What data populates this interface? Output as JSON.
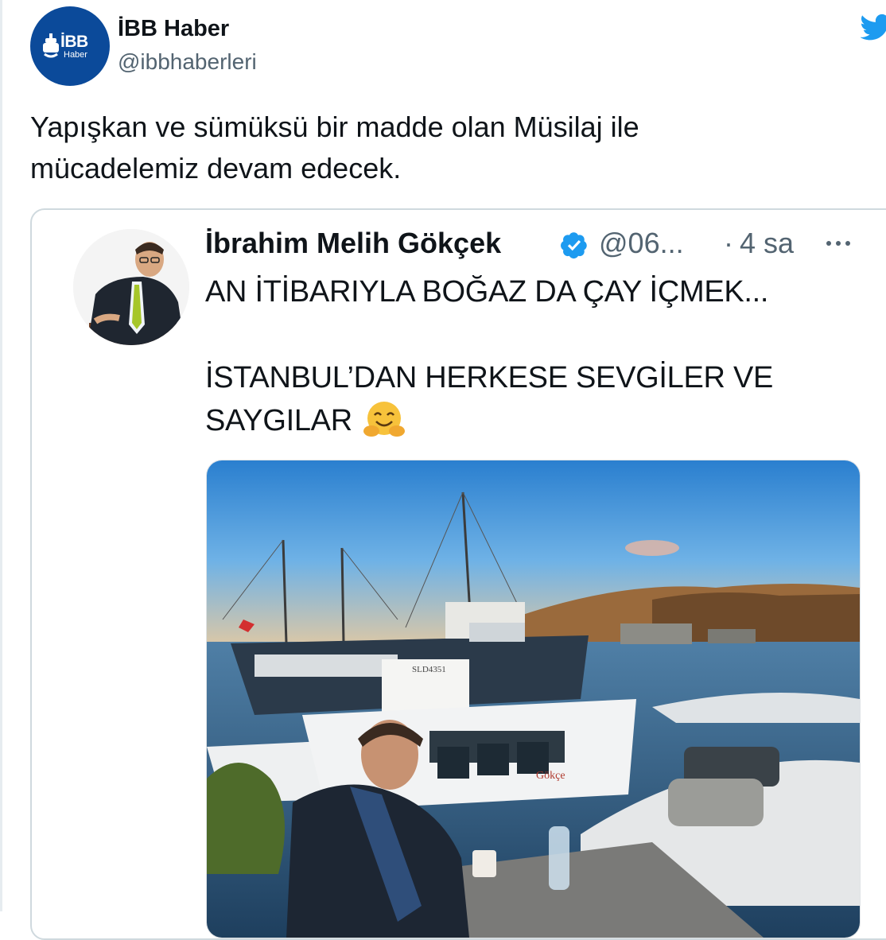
{
  "tweet": {
    "author_name": "İBB Haber",
    "author_handle": "@ibbhaberleri",
    "avatar_logo_text": "İBB",
    "avatar_logo_sub": "Haber",
    "text_line1": "Yapışkan ve sümüksü bir madde olan Müsilaj ile",
    "text_line2": "mücadelemiz devam edecek."
  },
  "quoted_tweet": {
    "author_name": "İbrahim Melih Gökçek",
    "author_handle": "@06...",
    "separator": "·",
    "time": "4 sa",
    "text_line1": "AN İTİBARIYLA BOĞAZ DA ÇAY İÇMEK...",
    "text_line2": "İSTANBUL’DAN HERKESE SEVGİLER VE",
    "text_line3": "SAYGILAR",
    "photo_boat_name": "Gökçe",
    "photo_boat_reg": "SLD4351"
  },
  "icons": {
    "platform": "twitter-bird-icon",
    "verified": "verified-badge-icon",
    "more": "more-options-icon",
    "emoji": "hugging-face-emoji"
  },
  "colors": {
    "twitter_blue": "#1d9bf0",
    "ibb_blue": "#0b4a9a",
    "text_primary": "#0f1419",
    "text_secondary": "#536471",
    "border": "#cfd9de"
  }
}
